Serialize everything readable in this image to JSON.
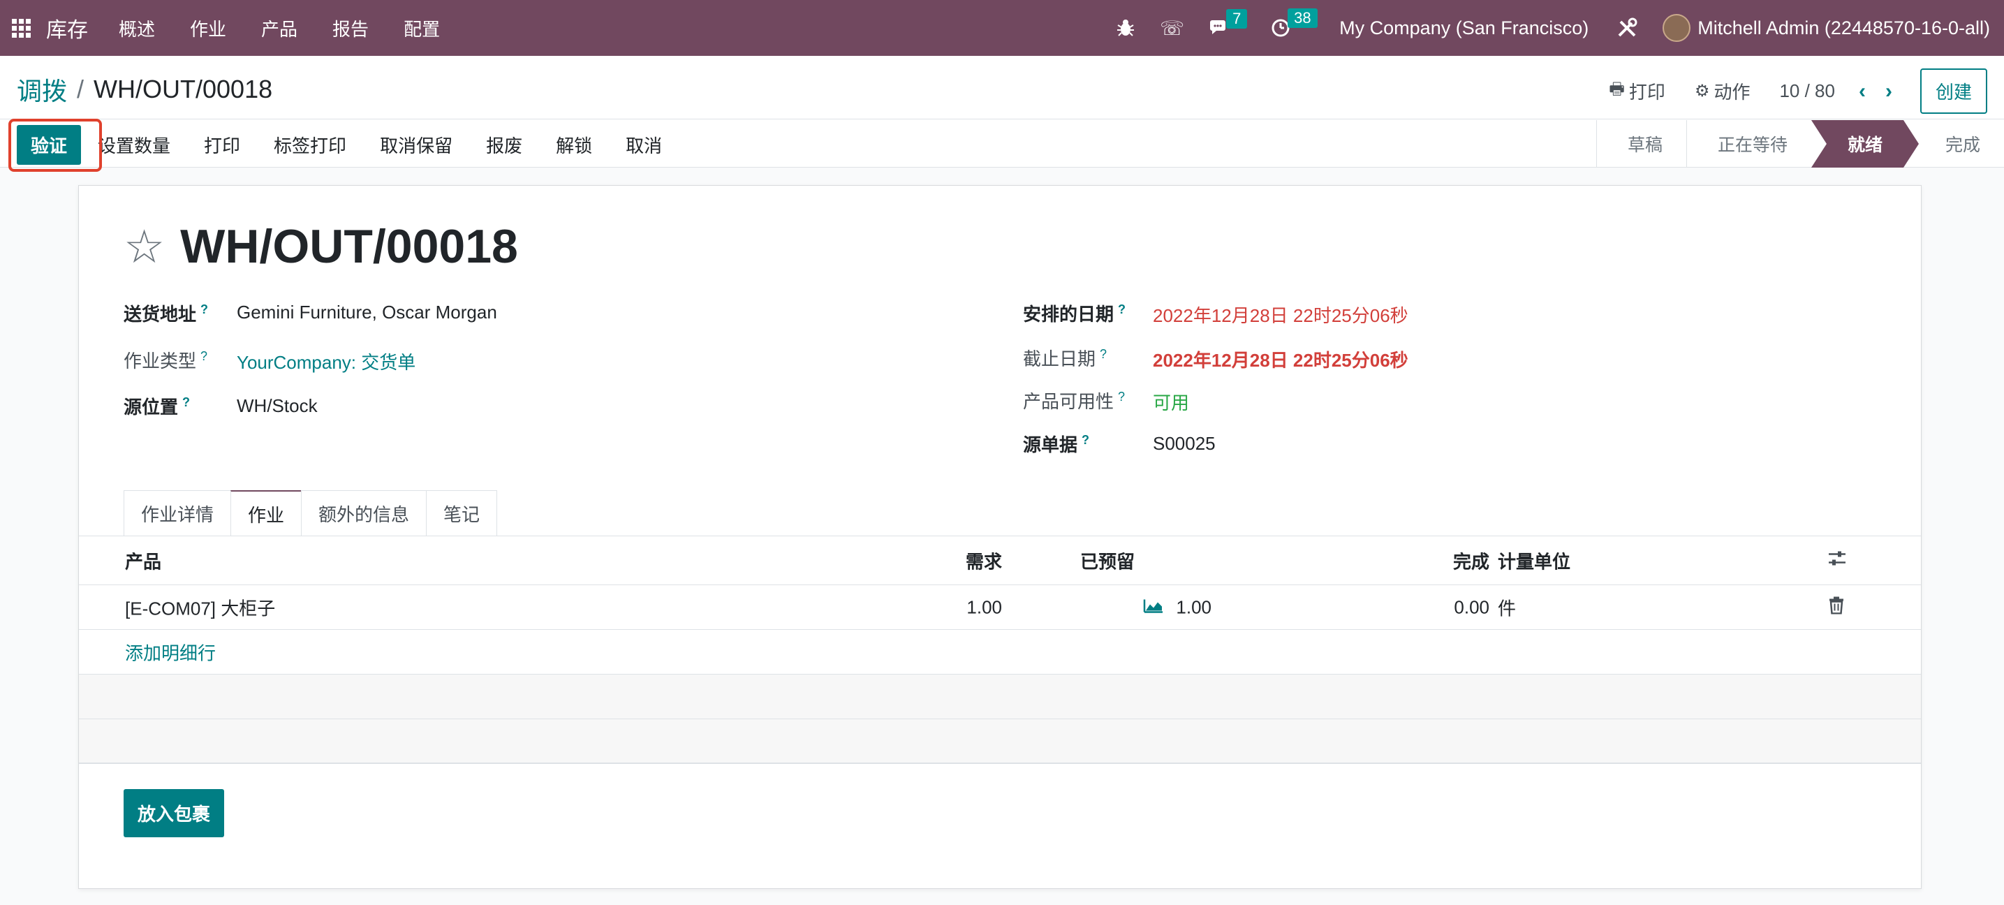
{
  "navbar": {
    "app_name": "库存",
    "menu": [
      "概述",
      "作业",
      "产品",
      "报告",
      "配置"
    ],
    "messages_count": "7",
    "activities_count": "38",
    "company": "My Company (San Francisco)",
    "user": "Mitchell Admin (22448570-16-0-all)"
  },
  "control": {
    "breadcrumb_parent": "调拨",
    "breadcrumb_separator": "/",
    "breadcrumb_current": "WH/OUT/00018",
    "print_label": "打印",
    "action_label": "动作",
    "pager": "10 / 80",
    "create_label": "创建"
  },
  "buttons": {
    "validate": "验证",
    "set_quantities": "设置数量",
    "print": "打印",
    "label_print": "标签打印",
    "unreserve": "取消保留",
    "scrap": "报废",
    "unlock": "解锁",
    "cancel": "取消"
  },
  "statusbar": [
    "草稿",
    "正在等待",
    "就绪",
    "完成"
  ],
  "record": {
    "title": "WH/OUT/00018",
    "delivery_address_label": "送货地址",
    "delivery_address": "Gemini Furniture, Oscar Morgan",
    "operation_type_label": "作业类型",
    "operation_type": "YourCompany: 交货单",
    "source_location_label": "源位置",
    "source_location": "WH/Stock",
    "scheduled_date_label": "安排的日期",
    "scheduled_date": "2022年12月28日 22时25分06秒",
    "deadline_label": "截止日期",
    "deadline": "2022年12月28日 22时25分06秒",
    "availability_label": "产品可用性",
    "availability": "可用",
    "source_document_label": "源单据",
    "source_document": "S00025",
    "help_mark": "?"
  },
  "tabs": [
    "作业详情",
    "作业",
    "额外的信息",
    "笔记"
  ],
  "table": {
    "headers": {
      "product": "产品",
      "demand": "需求",
      "reserved": "已预留",
      "done": "完成",
      "uom": "计量单位"
    },
    "rows": [
      {
        "product": "[E-COM07] 大柜子",
        "demand": "1.00",
        "reserved": "1.00",
        "done": "0.00",
        "uom": "件"
      }
    ],
    "add_line": "添加明细行"
  },
  "put_in_pack": "放入包裹",
  "colors": {
    "brand": "#71485f",
    "accent": "#017e84",
    "danger": "#d23f3a",
    "success": "#28a745",
    "highlight": "#e0412d"
  }
}
